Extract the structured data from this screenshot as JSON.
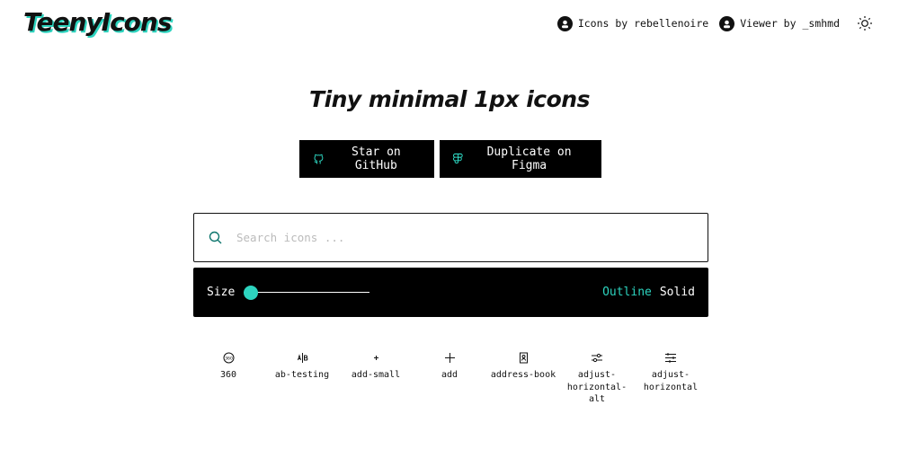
{
  "header": {
    "logo": "TeenyIcons",
    "links": [
      {
        "label": "Icons by rebellenoire",
        "icon": "avatar-icon"
      },
      {
        "label": "Viewer by _smhmd",
        "icon": "avatar-icon"
      }
    ],
    "theme_toggle_icon": "sun-icon"
  },
  "hero": {
    "title": "Tiny minimal 1px icons",
    "buttons": [
      {
        "label": "Star on GitHub",
        "icon": "github-icon"
      },
      {
        "label": "Duplicate on Figma",
        "icon": "figma-icon"
      }
    ]
  },
  "search": {
    "placeholder": "Search icons ...",
    "value": "",
    "icon": "search-icon"
  },
  "controls": {
    "size_label": "Size",
    "size_value": 0,
    "styles": [
      "Outline",
      "Solid"
    ],
    "active_style": "Outline"
  },
  "icons": [
    {
      "name": "360",
      "icon": "360-icon"
    },
    {
      "name": "ab-testing",
      "icon": "ab-testing-icon"
    },
    {
      "name": "add-small",
      "icon": "add-small-icon"
    },
    {
      "name": "add",
      "icon": "add-icon"
    },
    {
      "name": "address-book",
      "icon": "address-book-icon"
    },
    {
      "name": "adjust-horizontal-alt",
      "icon": "adjust-horizontal-alt-icon"
    },
    {
      "name": "adjust-horizontal",
      "icon": "adjust-horizontal-icon"
    }
  ],
  "colors": {
    "accent": "#2dd4bf",
    "background": "#ffffff",
    "foreground": "#111111",
    "bar": "#000000"
  }
}
